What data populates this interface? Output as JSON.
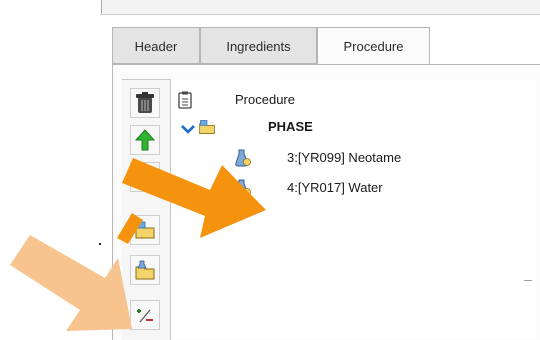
{
  "tabs": [
    {
      "label": "Header",
      "active": false
    },
    {
      "label": "Ingredients",
      "active": false
    },
    {
      "label": "Procedure",
      "active": true
    }
  ],
  "toolbar": {
    "buttons": [
      "trash-icon",
      "arrow-up-icon",
      "folder-add-icon",
      "folder-flask-icon",
      "plus-minus-icon"
    ]
  },
  "tree": {
    "root_label": "Procedure",
    "phase_label": "PHASE",
    "items": [
      {
        "label": "3:[YR099] Neotame"
      },
      {
        "label": "4:[YR017] Water"
      }
    ]
  },
  "colors": {
    "arrow_primary": "#f5930f",
    "arrow_secondary": "#f7c48f",
    "up_arrow": "#2fb52f",
    "folder": "#f2d46b"
  }
}
